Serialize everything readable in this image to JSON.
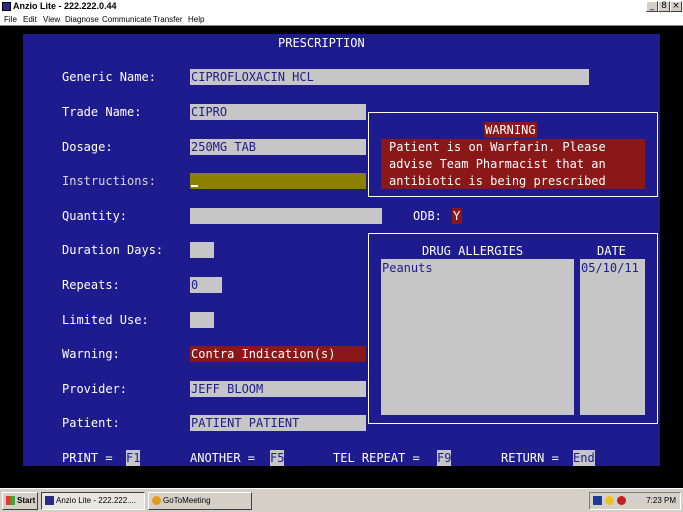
{
  "window": {
    "title": "Anzio Lite - 222.222.0.44",
    "minimize": "_",
    "maximize": "8",
    "close": "×"
  },
  "menu": [
    "File",
    "Edit",
    "View",
    "Diagnose",
    "Communicate",
    "Transfer",
    "Help"
  ],
  "screen": {
    "heading": "PRESCRIPTION",
    "fields": [
      {
        "label": "Generic Name:",
        "value": "CIPROFLOXACIN HCL"
      },
      {
        "label": "Trade Name:",
        "value": "CIPRO"
      },
      {
        "label": "Dosage:",
        "value": "250MG TAB"
      },
      {
        "label": "Instructions:",
        "value": ""
      },
      {
        "label": "Quantity:",
        "value": ""
      },
      {
        "label": "Duration Days:",
        "value": ""
      },
      {
        "label": "Repeats:",
        "value": "0"
      },
      {
        "label": "Limited Use:",
        "value": ""
      },
      {
        "label": "Warning:",
        "value": "Contra Indication(s)"
      },
      {
        "label": "Provider:",
        "value": "JEFF BLOOM"
      },
      {
        "label": "Patient:",
        "value": "PATIENT PATIENT"
      }
    ],
    "odb": {
      "label": "ODB:",
      "value": "Y"
    },
    "warning": {
      "title": "WARNING",
      "lines": [
        "Patient is on Warfarin. Please",
        "advise Team Pharmacist that an",
        "antibiotic is being prescribed"
      ]
    },
    "allergies": {
      "header_allergy": "DRUG ALLERGIES",
      "header_date": "DATE",
      "items": [
        {
          "allergy": "Peanuts",
          "date": "05/10/11"
        }
      ]
    },
    "function_keys": [
      {
        "label": "PRINT =",
        "key": "F1"
      },
      {
        "label": "ANOTHER =",
        "key": "F5"
      },
      {
        "label": "TEL REPEAT =",
        "key": "F9"
      },
      {
        "label": "RETURN =",
        "key": "End"
      }
    ]
  },
  "taskbar": {
    "start": "Start",
    "tasks": [
      "Anzio Lite - 222.222....",
      "GoToMeeting"
    ],
    "clock": "7:23 PM"
  },
  "colors": {
    "terminal_bg": "#1e1b8f",
    "field_bg": "#c6c6c6",
    "alert_bg": "#8b1818"
  }
}
